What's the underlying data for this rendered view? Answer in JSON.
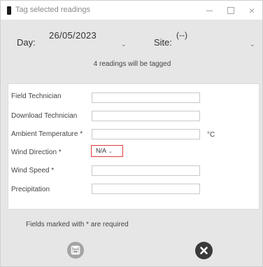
{
  "window": {
    "title": "Tag selected readings",
    "controls": {
      "minimize": "minimize-icon",
      "maximize": "maximize-icon",
      "close": "×"
    }
  },
  "filters": {
    "day_label": "Day:",
    "day_value": "26/05/2023",
    "site_label": "Site:",
    "site_value": "(--)"
  },
  "summary": {
    "text": "4 readings will be tagged"
  },
  "form": {
    "fields": [
      {
        "label": "Field Technician",
        "value": ""
      },
      {
        "label": "Download Technician",
        "value": ""
      },
      {
        "label": "Ambient Temperature *",
        "value": "",
        "unit": "°C"
      },
      {
        "label": "Wind Direction *",
        "value": "N/A"
      },
      {
        "label": "Wind Speed *",
        "value": ""
      },
      {
        "label": "Precipitation",
        "value": ""
      }
    ]
  },
  "footer": {
    "required_note": "Fields marked with * are required",
    "save_icon": "save-icon",
    "cancel_icon": "close-icon"
  },
  "colors": {
    "background": "#e6e6e6",
    "panel": "#ffffff",
    "invalid_border": "#e23d3d",
    "save_button": "#a4a4a4",
    "cancel_button": "#3a3a3a"
  }
}
